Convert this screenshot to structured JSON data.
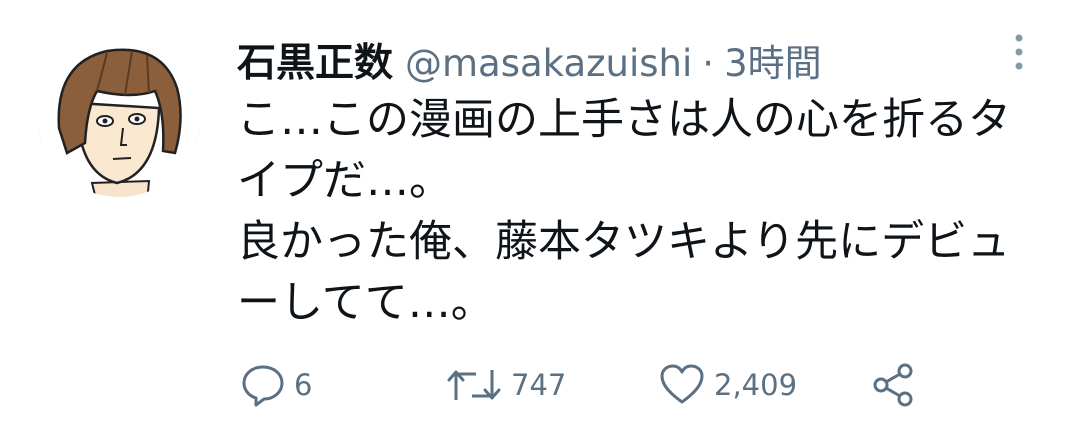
{
  "tweet": {
    "author": {
      "display_name": "石黒正数",
      "handle": "@masakazuishi"
    },
    "separator": "·",
    "time": "3時間",
    "text": "こ…この漫画の上手さは人の心を折るタ\nイプだ…。\n良かった俺、藤本タツキより先にデビュ\nーしてて…。",
    "actions": {
      "reply_count": "6",
      "retweet_count": "747",
      "like_count": "2,409"
    }
  },
  "icons": {
    "more": "more-vertical-icon",
    "reply": "comment-bubble-icon",
    "retweet": "retweet-icon",
    "like": "heart-icon",
    "share": "share-icon"
  },
  "colors": {
    "text": "#0f1419",
    "secondary": "#5b7083",
    "avatar_accent": "#7aa6e8"
  }
}
